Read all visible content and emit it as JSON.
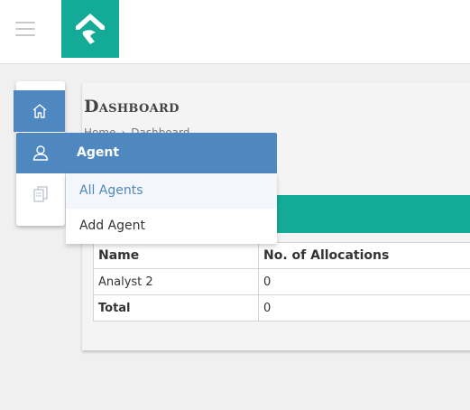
{
  "header": {
    "menu_icon": "hamburger-icon",
    "logo_icon": "brand-logo",
    "logo_color": "#14aa98"
  },
  "sidebar": {
    "items": [
      {
        "icon": "home-icon",
        "active": true
      },
      {
        "icon": "documents-icon",
        "active": false
      }
    ],
    "active_color": "#4f87c1"
  },
  "page": {
    "title": "Dashboard",
    "breadcrumb": [
      "Home",
      "Dashboard"
    ]
  },
  "dropdown": {
    "header_label": "Agent",
    "header_icon": "user-icon",
    "items": [
      {
        "label": "All Agents",
        "active": true
      },
      {
        "label": "Add Agent",
        "active": false
      }
    ]
  },
  "table": {
    "columns": [
      "Name",
      "No. of Allocations"
    ],
    "rows": [
      {
        "name": "Analyst 2",
        "allocations": "0"
      },
      {
        "name": "Total",
        "allocations": "0"
      }
    ]
  },
  "colors": {
    "accent": "#14aa98",
    "primary": "#4f87c1"
  }
}
